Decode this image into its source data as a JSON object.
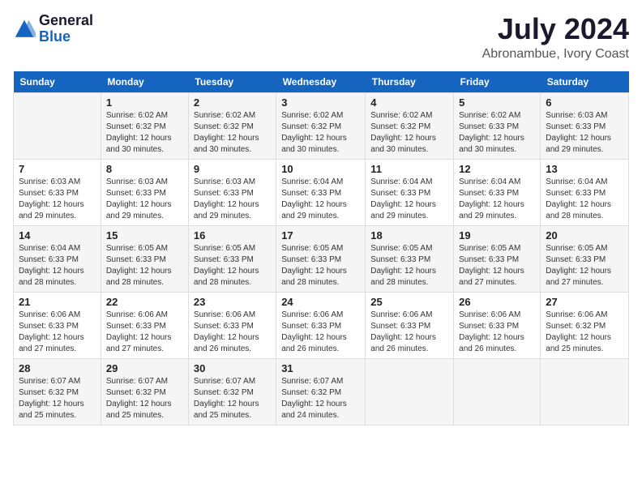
{
  "header": {
    "logo_general": "General",
    "logo_blue": "Blue",
    "title": "July 2024",
    "subtitle": "Abronambue, Ivory Coast"
  },
  "calendar": {
    "days_of_week": [
      "Sunday",
      "Monday",
      "Tuesday",
      "Wednesday",
      "Thursday",
      "Friday",
      "Saturday"
    ],
    "weeks": [
      [
        {
          "day": "",
          "sunrise": "",
          "sunset": "",
          "daylight": ""
        },
        {
          "day": "1",
          "sunrise": "6:02 AM",
          "sunset": "6:32 PM",
          "daylight": "12 hours and 30 minutes."
        },
        {
          "day": "2",
          "sunrise": "6:02 AM",
          "sunset": "6:32 PM",
          "daylight": "12 hours and 30 minutes."
        },
        {
          "day": "3",
          "sunrise": "6:02 AM",
          "sunset": "6:32 PM",
          "daylight": "12 hours and 30 minutes."
        },
        {
          "day": "4",
          "sunrise": "6:02 AM",
          "sunset": "6:32 PM",
          "daylight": "12 hours and 30 minutes."
        },
        {
          "day": "5",
          "sunrise": "6:02 AM",
          "sunset": "6:33 PM",
          "daylight": "12 hours and 30 minutes."
        },
        {
          "day": "6",
          "sunrise": "6:03 AM",
          "sunset": "6:33 PM",
          "daylight": "12 hours and 29 minutes."
        }
      ],
      [
        {
          "day": "7",
          "sunrise": "6:03 AM",
          "sunset": "6:33 PM",
          "daylight": "12 hours and 29 minutes."
        },
        {
          "day": "8",
          "sunrise": "6:03 AM",
          "sunset": "6:33 PM",
          "daylight": "12 hours and 29 minutes."
        },
        {
          "day": "9",
          "sunrise": "6:03 AM",
          "sunset": "6:33 PM",
          "daylight": "12 hours and 29 minutes."
        },
        {
          "day": "10",
          "sunrise": "6:04 AM",
          "sunset": "6:33 PM",
          "daylight": "12 hours and 29 minutes."
        },
        {
          "day": "11",
          "sunrise": "6:04 AM",
          "sunset": "6:33 PM",
          "daylight": "12 hours and 29 minutes."
        },
        {
          "day": "12",
          "sunrise": "6:04 AM",
          "sunset": "6:33 PM",
          "daylight": "12 hours and 29 minutes."
        },
        {
          "day": "13",
          "sunrise": "6:04 AM",
          "sunset": "6:33 PM",
          "daylight": "12 hours and 28 minutes."
        }
      ],
      [
        {
          "day": "14",
          "sunrise": "6:04 AM",
          "sunset": "6:33 PM",
          "daylight": "12 hours and 28 minutes."
        },
        {
          "day": "15",
          "sunrise": "6:05 AM",
          "sunset": "6:33 PM",
          "daylight": "12 hours and 28 minutes."
        },
        {
          "day": "16",
          "sunrise": "6:05 AM",
          "sunset": "6:33 PM",
          "daylight": "12 hours and 28 minutes."
        },
        {
          "day": "17",
          "sunrise": "6:05 AM",
          "sunset": "6:33 PM",
          "daylight": "12 hours and 28 minutes."
        },
        {
          "day": "18",
          "sunrise": "6:05 AM",
          "sunset": "6:33 PM",
          "daylight": "12 hours and 28 minutes."
        },
        {
          "day": "19",
          "sunrise": "6:05 AM",
          "sunset": "6:33 PM",
          "daylight": "12 hours and 27 minutes."
        },
        {
          "day": "20",
          "sunrise": "6:05 AM",
          "sunset": "6:33 PM",
          "daylight": "12 hours and 27 minutes."
        }
      ],
      [
        {
          "day": "21",
          "sunrise": "6:06 AM",
          "sunset": "6:33 PM",
          "daylight": "12 hours and 27 minutes."
        },
        {
          "day": "22",
          "sunrise": "6:06 AM",
          "sunset": "6:33 PM",
          "daylight": "12 hours and 27 minutes."
        },
        {
          "day": "23",
          "sunrise": "6:06 AM",
          "sunset": "6:33 PM",
          "daylight": "12 hours and 26 minutes."
        },
        {
          "day": "24",
          "sunrise": "6:06 AM",
          "sunset": "6:33 PM",
          "daylight": "12 hours and 26 minutes."
        },
        {
          "day": "25",
          "sunrise": "6:06 AM",
          "sunset": "6:33 PM",
          "daylight": "12 hours and 26 minutes."
        },
        {
          "day": "26",
          "sunrise": "6:06 AM",
          "sunset": "6:33 PM",
          "daylight": "12 hours and 26 minutes."
        },
        {
          "day": "27",
          "sunrise": "6:06 AM",
          "sunset": "6:32 PM",
          "daylight": "12 hours and 25 minutes."
        }
      ],
      [
        {
          "day": "28",
          "sunrise": "6:07 AM",
          "sunset": "6:32 PM",
          "daylight": "12 hours and 25 minutes."
        },
        {
          "day": "29",
          "sunrise": "6:07 AM",
          "sunset": "6:32 PM",
          "daylight": "12 hours and 25 minutes."
        },
        {
          "day": "30",
          "sunrise": "6:07 AM",
          "sunset": "6:32 PM",
          "daylight": "12 hours and 25 minutes."
        },
        {
          "day": "31",
          "sunrise": "6:07 AM",
          "sunset": "6:32 PM",
          "daylight": "12 hours and 24 minutes."
        },
        {
          "day": "",
          "sunrise": "",
          "sunset": "",
          "daylight": ""
        },
        {
          "day": "",
          "sunrise": "",
          "sunset": "",
          "daylight": ""
        },
        {
          "day": "",
          "sunrise": "",
          "sunset": "",
          "daylight": ""
        }
      ]
    ]
  }
}
